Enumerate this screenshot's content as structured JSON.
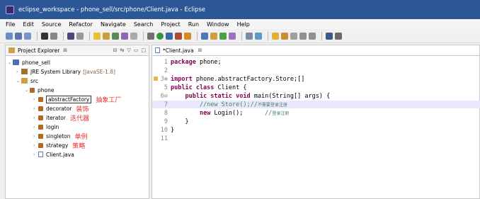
{
  "window": {
    "title": "eclipse_workspace - phone_sell/src/phone/Client.java - Eclipse"
  },
  "menu": [
    "File",
    "Edit",
    "Source",
    "Refactor",
    "Navigate",
    "Search",
    "Project",
    "Run",
    "Window",
    "Help"
  ],
  "explorer": {
    "tab_label": "Project Explorer",
    "close": "⊠",
    "tree": {
      "project": "phone_sell",
      "jre_label": "JRE System Library",
      "jre_version": "[JavaSE-1.8]",
      "src": "src",
      "package": "phone",
      "packages": [
        {
          "name": "abstractFactory",
          "note": "抽象工厂"
        },
        {
          "name": "decorator",
          "note": "装饰"
        },
        {
          "name": "iterator",
          "note": "迭代器"
        },
        {
          "name": "login",
          "note": ""
        },
        {
          "name": "singleton",
          "note": "单例"
        },
        {
          "name": "strategy",
          "note": "策略"
        }
      ],
      "file": "Client.java"
    }
  },
  "editor": {
    "tab_label": "*Client.java",
    "close": "⊠",
    "lines": [
      {
        "n": "1",
        "kw": "package",
        "text": " phone;"
      },
      {
        "n": "2",
        "text": ""
      },
      {
        "n": "3⊕",
        "kw": "import",
        "text": " phone.abstractFactory.Store;[]"
      },
      {
        "n": "5",
        "kw": "public class",
        "text": " Client {"
      },
      {
        "n": "6⊖",
        "text": "    ",
        "kw2": "public static void",
        "text2": " main(String[] args) {"
      },
      {
        "n": "7",
        "comment": "        //new Store();//",
        "comment_cn": "不需要登录注册"
      },
      {
        "n": "8",
        "text": "        ",
        "kw2": "new",
        "text2": " Login();      ",
        "comment": "//",
        "comment_cn": "登录注册"
      },
      {
        "n": "9",
        "text": "    }"
      },
      {
        "n": "10",
        "text": "}"
      },
      {
        "n": "11",
        "text": ""
      }
    ]
  }
}
